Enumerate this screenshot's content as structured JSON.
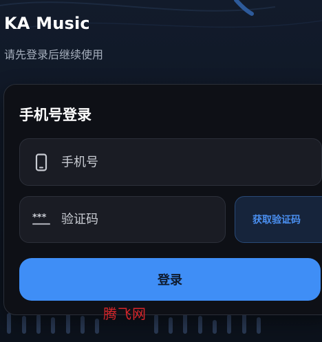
{
  "header": {
    "app_title": "KA Music",
    "subtitle": "请先登录后继续使用"
  },
  "login_card": {
    "title": "手机号登录",
    "phone_field": {
      "placeholder": "手机号",
      "value": "",
      "icon": "smartphone-icon"
    },
    "code_field": {
      "placeholder": "验证码",
      "value": "",
      "icon": "password-dots-icon"
    },
    "get_code_label": "获取验证码",
    "login_label": "登录"
  },
  "watermark": "腾飞网",
  "colors": {
    "background": "#111a29",
    "card": "#0e1016",
    "field": "#1a1c24",
    "accent": "#3f8ef6",
    "get_code_text": "#4a8ff0",
    "subtitle": "#a7b0be",
    "watermark": "#d7262b"
  }
}
